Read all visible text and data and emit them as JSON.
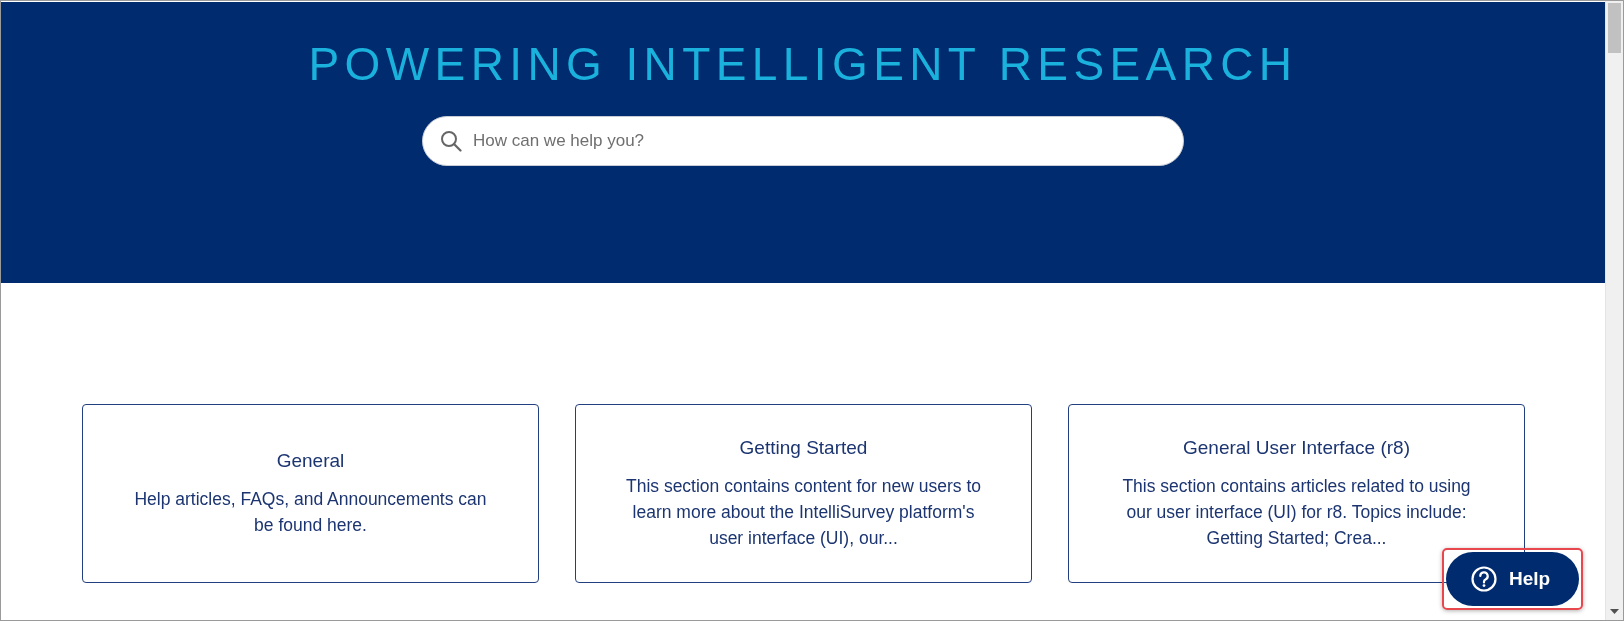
{
  "header": {
    "title": "POWERING INTELLIGENT RESEARCH",
    "search": {
      "placeholder": "How can we help you?"
    }
  },
  "cards": [
    {
      "title": "General",
      "description": "Help articles, FAQs, and Announcements can be found here."
    },
    {
      "title": "Getting Started",
      "description": "This section contains content for new users to learn more about the IntelliSurvey platform's user interface (UI), our..."
    },
    {
      "title": "General User Interface (r8)",
      "description": "This section contains articles related to using our user interface (UI) for r8. Topics include: Getting Started; Crea..."
    }
  ],
  "help_button": {
    "label": "Help"
  }
}
